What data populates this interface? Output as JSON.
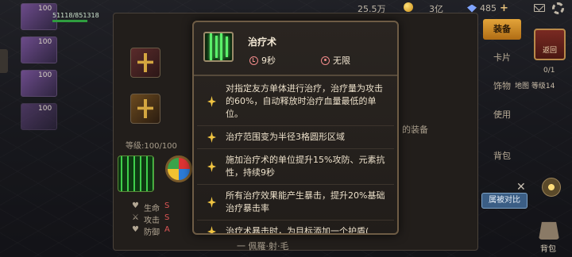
{
  "topbar": {
    "gold_amount": "25.5万",
    "diamond_amount": "3亿",
    "energy_amount": "485",
    "plus_label": "+"
  },
  "party": [
    {
      "level": "100",
      "hp_text": "51118/851318"
    },
    {
      "level": "100"
    },
    {
      "level": "100"
    },
    {
      "level": "100"
    }
  ],
  "equipment_panel": {
    "level_label": "等级:100/100",
    "hint_text": "的装备",
    "stats": [
      {
        "label": "生命",
        "value": "S"
      },
      {
        "label": "攻击",
        "value": "S"
      },
      {
        "label": "防御",
        "value": "A"
      }
    ],
    "bottom_text": "一 佩羅·射·毛"
  },
  "right_tabs": {
    "equip": "装备",
    "card": "卡片",
    "accessory": "饰物",
    "use": "使用",
    "backpack": "背包"
  },
  "back_button_label": "返回",
  "page_count": "0/1",
  "map_level": "地图 等级14",
  "compare_button_label": "属被对比",
  "bag_label": "背包",
  "tooltip": {
    "skill_name": "治疗术",
    "cooldown": "9秒",
    "range": "无限",
    "effects": [
      "对指定友方单体进行治疗，治疗量为攻击的60%，自动释放时治疗血量最低的单位。",
      "治疗范围变为半径3格圆形区域",
      "施加治疗术的单位提升15%攻防、元素抗性，持续9秒",
      "所有治疗效果能产生暴击，提升20%基础治疗暴击率",
      "治疗术暴击时，为目标添加一个护盾("
    ]
  },
  "colors": {
    "accent_gold": "#e3a43a",
    "tooltip_border": "#6e5c45",
    "star": "#f1c542",
    "icon_red": "#f08a8a"
  }
}
